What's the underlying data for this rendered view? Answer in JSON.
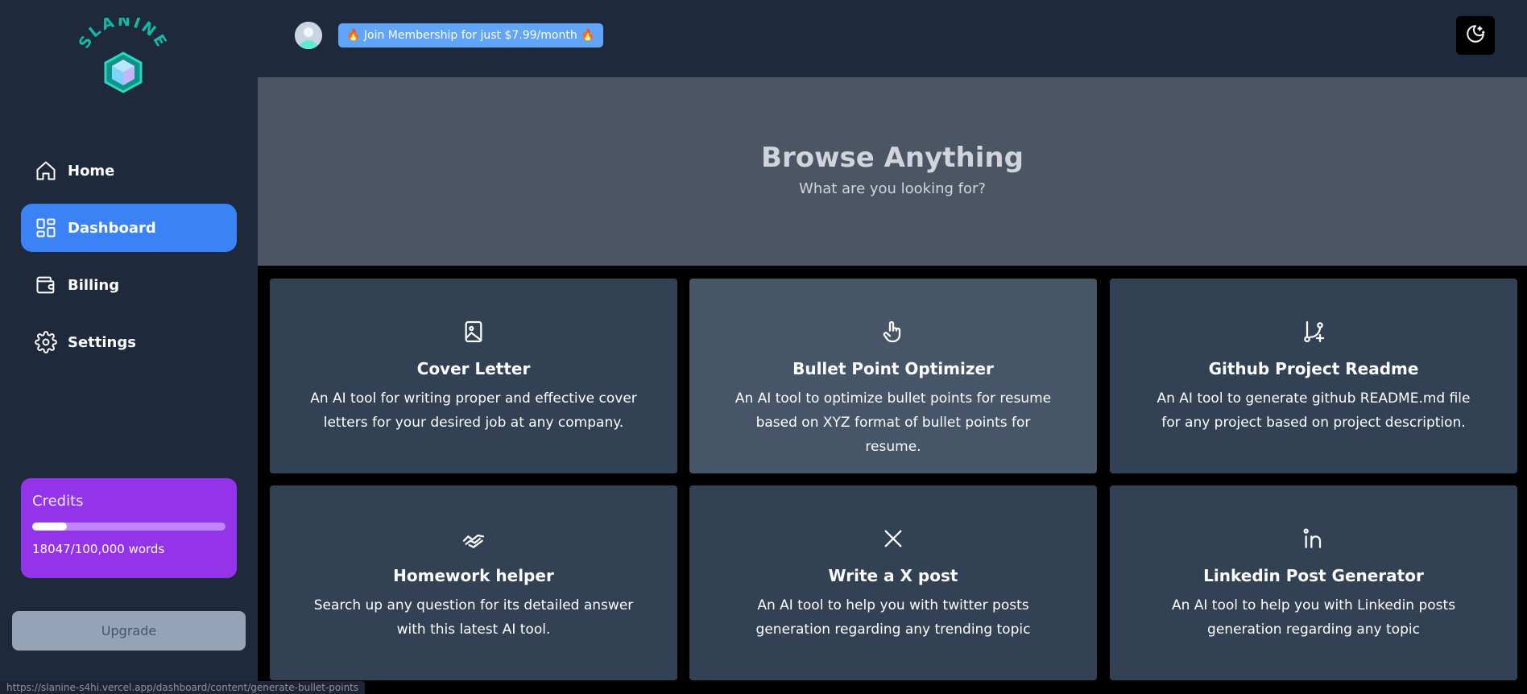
{
  "brand": {
    "logo_text": "SLANINE"
  },
  "sidebar": {
    "items": [
      {
        "label": "Home",
        "icon": "home-icon",
        "active": false
      },
      {
        "label": "Dashboard",
        "icon": "dashboard-icon",
        "active": true
      },
      {
        "label": "Billing",
        "icon": "wallet-icon",
        "active": false
      },
      {
        "label": "Settings",
        "icon": "gear-icon",
        "active": false
      }
    ],
    "credits": {
      "title": "Credits",
      "used": 18047,
      "total": 100000,
      "progress_fraction": 0.18,
      "text": "18047/100,000 words"
    },
    "upgrade_label": "Upgrade"
  },
  "status_bar": {
    "url": "https://slanine-s4hi.vercel.app/dashboard/content/generate-bullet-points"
  },
  "header": {
    "membership_label": "🔥 Join Membership for just $7.99/month 🔥",
    "theme_toggle_icon": "moon-stars-icon"
  },
  "hero": {
    "title": "Browse Anything",
    "subtitle": "What are you looking for?"
  },
  "cards": [
    {
      "title": "Cover Letter",
      "desc": "An AI tool for writing proper and effective cover letters for your desired job at any company.",
      "icon": "image-file-icon"
    },
    {
      "title": "Bullet Point Optimizer",
      "desc": "An AI tool to optimize bullet points for resume based on XYZ format of bullet points for resume.",
      "icon": "hand-pointer-icon"
    },
    {
      "title": "Github Project Readme",
      "desc": "An AI tool to generate github README.md file for any project based on project description.",
      "icon": "git-branch-plus-icon"
    },
    {
      "title": "Homework helper",
      "desc": "Search up any question for its detailed answer with this latest AI tool.",
      "icon": "handshake-icon"
    },
    {
      "title": "Write a X post",
      "desc": "An AI tool to help you with twitter posts generation regarding any trending topic",
      "icon": "x-logo-icon"
    },
    {
      "title": "Linkedin Post Generator",
      "desc": "An AI tool to help you with Linkedin posts generation regarding any topic",
      "icon": "linkedin-icon"
    }
  ],
  "colors": {
    "sidebar_bg": "#1e293b",
    "accent": "#3b82f6",
    "credits_bg": "#9333ea",
    "card_bg": "#334155",
    "card_hover_bg": "#475569",
    "hero_bg": "#4b5563"
  }
}
